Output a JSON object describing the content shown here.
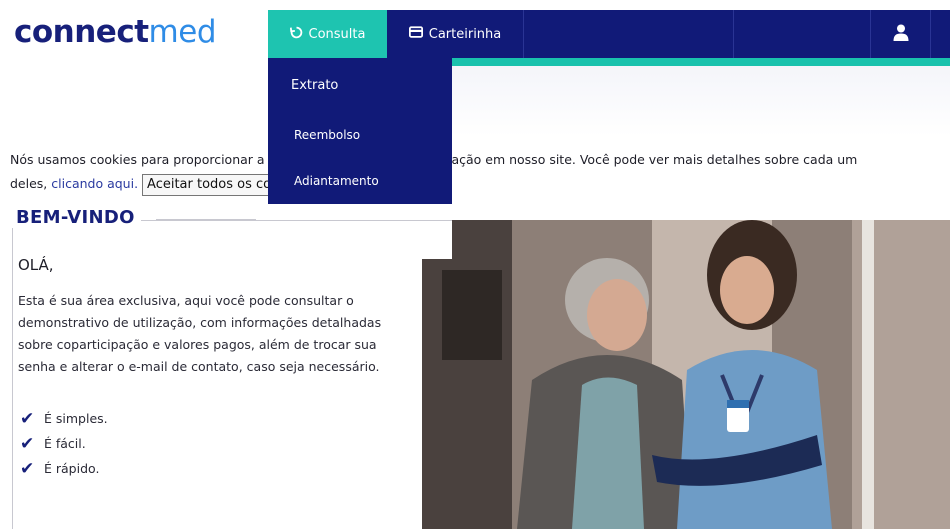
{
  "brand": {
    "logo_bold": "connect",
    "logo_light": "med"
  },
  "nav": {
    "consulta": "Consulta",
    "carteirinha": "Carteirinha",
    "user_icon": "user-icon"
  },
  "dropdown": {
    "items": [
      "Extrato",
      "Reembolso",
      "Adiantamento"
    ]
  },
  "cookie": {
    "line1": "Nós usamos cookies para proporcionar a melhor experiência de navegação em nosso site. Você pode ver mais detalhes sobre cada um",
    "line2_prefix": "deles, ",
    "link": "clicando aqui.",
    "button": "Aceitar todos os cookies"
  },
  "welcome": {
    "legend": "BEM-VINDO",
    "greeting": "OLÁ,",
    "description": "Esta é sua área exclusiva, aqui você pode consultar o demonstrativo de utilização, com informações detalhadas sobre coparticipação e valores pagos, além de trocar sua senha e alterar o e-mail de contato, caso seja necessário.",
    "checks": [
      "É simples.",
      "É fácil.",
      "É rápido."
    ]
  },
  "colors": {
    "navy": "#111a78",
    "teal": "#1ec4b0",
    "brand_light": "#2f8ce6"
  }
}
